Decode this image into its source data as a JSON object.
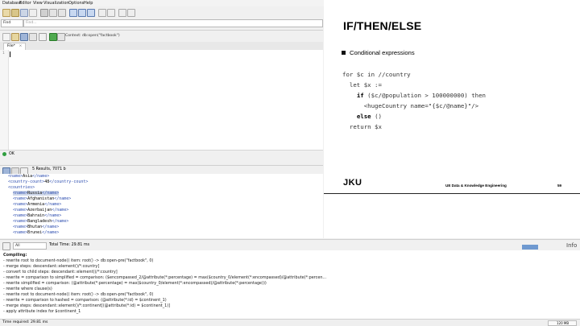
{
  "menu": [
    "Database",
    "Editor",
    "View",
    "Visualization",
    "Options",
    "Help"
  ],
  "find": {
    "mode": "Find",
    "placeholder": "Find..."
  },
  "editor": {
    "context": "Context: db:open(\"factbook\")",
    "tab_label": "File*",
    "line_number": "1"
  },
  "status": {
    "ok": "OK",
    "time_required": "Time required: 29.81 ms",
    "memory": "120 MB"
  },
  "results": {
    "summary": "5 Results, 7071 b",
    "lines": [
      {
        "indent": "  ",
        "open": "<name>",
        "text": "Asia",
        "close": "</name>"
      },
      {
        "indent": "  ",
        "open": "<country-count>",
        "text": "48",
        "close": "</country-count>"
      },
      {
        "indent": "  ",
        "open": "<countries>",
        "text": "",
        "close": ""
      },
      {
        "indent": "    ",
        "open": "<name>",
        "text": "Russia",
        "close": "</name>",
        "highlight": true
      },
      {
        "indent": "    ",
        "open": "<name>",
        "text": "Afghanistan",
        "close": "</name>"
      },
      {
        "indent": "    ",
        "open": "<name>",
        "text": "Armenia",
        "close": "</name>"
      },
      {
        "indent": "    ",
        "open": "<name>",
        "text": "Azerbaijan",
        "close": "</name>"
      },
      {
        "indent": "    ",
        "open": "<name>",
        "text": "Bahrain",
        "close": "</name>"
      },
      {
        "indent": "    ",
        "open": "<name>",
        "text": "Bangladesh",
        "close": "</name>"
      },
      {
        "indent": "    ",
        "open": "<name>",
        "text": "Bhutan",
        "close": "</name>"
      },
      {
        "indent": "    ",
        "open": "<name>",
        "text": "Brunei",
        "close": "</name>"
      }
    ]
  },
  "slide": {
    "title": "IF/THEN/ELSE",
    "bullet": "Conditional expressions",
    "code": [
      {
        "pre": "for $c in //country",
        "kw": "",
        "post": ""
      },
      {
        "pre": "  let $x :=",
        "kw": "",
        "post": ""
      },
      {
        "pre": "    ",
        "kw": "if",
        "post": " ($c/@population > 100000000) then"
      },
      {
        "pre": "      <hugeCountry name=\"{$c/@name}\"/>",
        "kw": "",
        "post": ""
      },
      {
        "pre": "    ",
        "kw": "else",
        "post": " ()"
      },
      {
        "pre": "  return $x",
        "kw": "",
        "post": ""
      }
    ],
    "logo": "JKU",
    "footer": "UE Data & Knowledge Engineering",
    "page": "59"
  },
  "info": {
    "filter": "All",
    "total_time": "Total Time: 29.81 ms",
    "label": "Info",
    "lines": [
      "Compiling:",
      "- rewrite root to document-node() item: root() -> db:open-pre(\"factbook\", 0)",
      "- merge steps: descendant::element()/*:country]",
      "- convert to child steps: descendant::element()/*:country]",
      "- rewrite = comparison to simplified = comparison: ($encompassed_2/@attribute(*:percentage) = max($country_0/element(*:encompassed)/@attribute(*:percen...",
      "- rewrite simplified = comparison: (@attribute(*:percentage) = max($country_0/element(*:encompassed)/@attribute(*:percentage)))",
      "- rewrite where clause(s)",
      "- rewrite root to document-node() item: root() -> db:open-pre(\"factbook\", 0)",
      "- rewrite = comparison to hashed = comparison: (@attribute(*:id) = $continent_1)",
      "- merge steps: descendant::element()/*:continent[(@attribute(*:id) = $continent_1)]",
      "- apply attribute index for $continent_1"
    ]
  }
}
